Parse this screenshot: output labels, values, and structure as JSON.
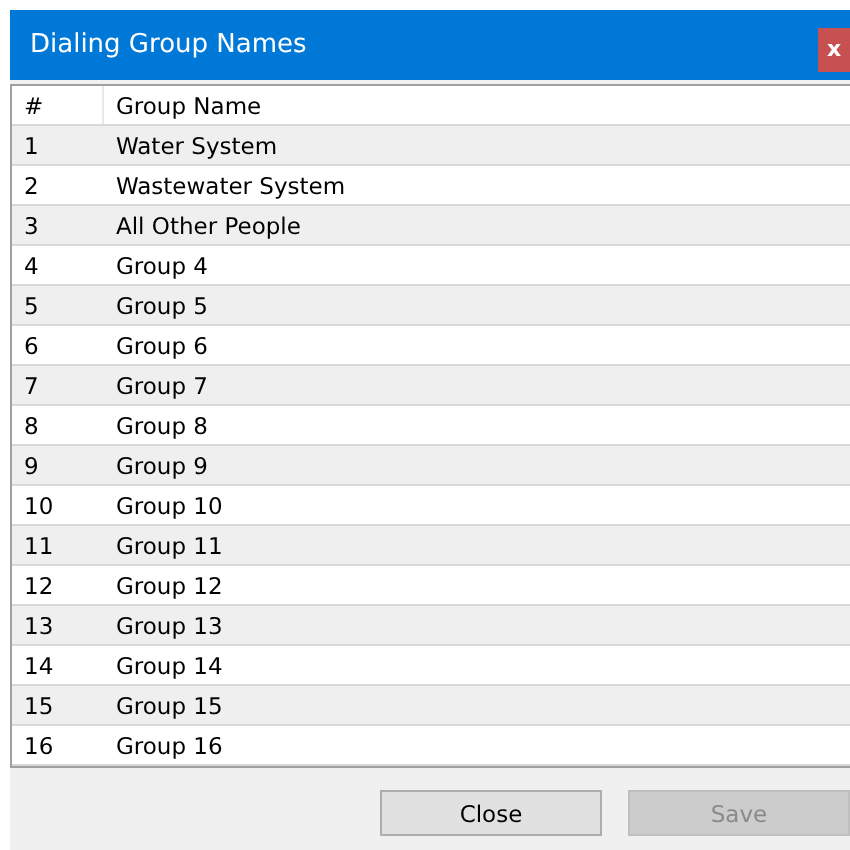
{
  "window": {
    "title": "Dialing Group Names",
    "close": "x"
  },
  "table": {
    "columns": [
      "#",
      "Group Name"
    ],
    "rows": [
      {
        "number": "1",
        "name": "Water System"
      },
      {
        "number": "2",
        "name": "Wastewater System"
      },
      {
        "number": "3",
        "name": "All Other People"
      },
      {
        "number": "4",
        "name": "Group 4"
      },
      {
        "number": "5",
        "name": "Group 5"
      },
      {
        "number": "6",
        "name": "Group 6"
      },
      {
        "number": "7",
        "name": "Group 7"
      },
      {
        "number": "8",
        "name": "Group 8"
      },
      {
        "number": "9",
        "name": "Group 9"
      },
      {
        "number": "10",
        "name": "Group 10"
      },
      {
        "number": "11",
        "name": "Group 11"
      },
      {
        "number": "12",
        "name": "Group 12"
      },
      {
        "number": "13",
        "name": "Group 13"
      },
      {
        "number": "14",
        "name": "Group 14"
      },
      {
        "number": "15",
        "name": "Group 15"
      },
      {
        "number": "16",
        "name": "Group 16"
      }
    ]
  },
  "buttons": [
    {
      "label": "Close",
      "disabled": false
    },
    {
      "label": "Save",
      "disabled": true
    }
  ]
}
